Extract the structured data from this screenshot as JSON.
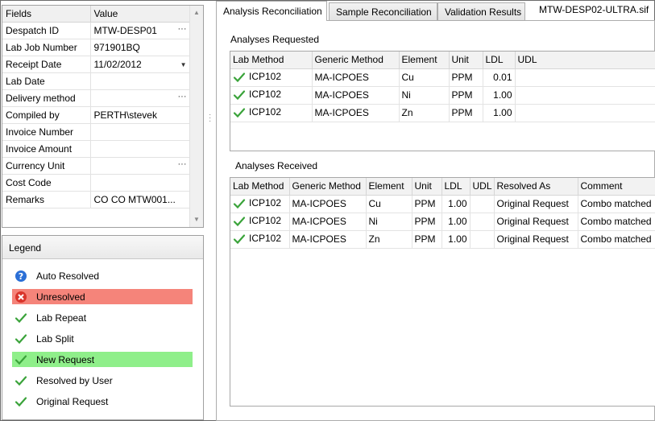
{
  "properties": {
    "headers": {
      "field": "Fields",
      "value": "Value"
    },
    "rows": [
      {
        "field": "Despatch ID",
        "value": "MTW-DESP01",
        "control": "ellipsis"
      },
      {
        "field": "Lab Job Number",
        "value": "971901BQ",
        "control": ""
      },
      {
        "field": "Receipt Date",
        "value": "11/02/2012",
        "control": "dropdown"
      },
      {
        "field": "Lab Date",
        "value": "",
        "control": ""
      },
      {
        "field": "Delivery method",
        "value": "",
        "control": "ellipsis"
      },
      {
        "field": "Compiled by",
        "value": "PERTH\\stevek",
        "control": ""
      },
      {
        "field": "Invoice Number",
        "value": "",
        "control": ""
      },
      {
        "field": "Invoice Amount",
        "value": "",
        "control": ""
      },
      {
        "field": "Currency Unit",
        "value": "",
        "control": "ellipsis"
      },
      {
        "field": "Cost Code",
        "value": "",
        "control": ""
      },
      {
        "field": "Remarks",
        "value": "CO CO MTW001...",
        "control": ""
      }
    ],
    "ellipsis_glyph": "···",
    "dropdown_glyph": "▼"
  },
  "legend": {
    "title": "Legend",
    "items": [
      {
        "label": "Auto Resolved",
        "icon": "help-circle-icon",
        "highlight": "none"
      },
      {
        "label": "Unresolved",
        "icon": "error-x-icon",
        "highlight": "#f5847a"
      },
      {
        "label": "Lab Repeat",
        "icon": "checkmark-icon",
        "highlight": "none"
      },
      {
        "label": "Lab Split",
        "icon": "checkmark-icon",
        "highlight": "none"
      },
      {
        "label": "New Request",
        "icon": "checkmark-icon",
        "highlight": "#8fef8a"
      },
      {
        "label": "Resolved by User",
        "icon": "checkmark-icon",
        "highlight": "none"
      },
      {
        "label": "Original Request",
        "icon": "checkmark-icon",
        "highlight": "none"
      }
    ]
  },
  "tabs": [
    {
      "label": "Analysis Reconciliation",
      "active": true
    },
    {
      "label": "Sample Reconciliation",
      "active": false
    },
    {
      "label": "Validation Results",
      "active": false
    }
  ],
  "file_name": "MTW-DESP02-ULTRA.sif",
  "requested": {
    "title": "Analyses Requested",
    "columns": [
      "Lab Method",
      "Generic Method",
      "Element",
      "Unit",
      "LDL",
      "UDL"
    ],
    "rows": [
      {
        "lab_method": "ICP102",
        "generic_method": "MA-ICPOES",
        "element": "Cu",
        "unit": "PPM",
        "ldl": "0.01",
        "udl": ""
      },
      {
        "lab_method": "ICP102",
        "generic_method": "MA-ICPOES",
        "element": "Ni",
        "unit": "PPM",
        "ldl": "1.00",
        "udl": ""
      },
      {
        "lab_method": "ICP102",
        "generic_method": "MA-ICPOES",
        "element": "Zn",
        "unit": "PPM",
        "ldl": "1.00",
        "udl": ""
      }
    ]
  },
  "received": {
    "title": "Analyses Received",
    "columns": [
      "Lab Method",
      "Generic Method",
      "Element",
      "Unit",
      "LDL",
      "UDL",
      "Resolved As",
      "Comment"
    ],
    "rows": [
      {
        "lab_method": "ICP102",
        "generic_method": "MA-ICPOES",
        "element": "Cu",
        "unit": "PPM",
        "ldl": "1.00",
        "udl": "",
        "resolved_as": "Original Request",
        "comment": "Combo matched"
      },
      {
        "lab_method": "ICP102",
        "generic_method": "MA-ICPOES",
        "element": "Ni",
        "unit": "PPM",
        "ldl": "1.00",
        "udl": "",
        "resolved_as": "Original Request",
        "comment": "Combo matched"
      },
      {
        "lab_method": "ICP102",
        "generic_method": "MA-ICPOES",
        "element": "Zn",
        "unit": "PPM",
        "ldl": "1.00",
        "udl": "",
        "resolved_as": "Original Request",
        "comment": "Combo matched"
      }
    ]
  },
  "colors": {
    "check_green": "#3aa33a",
    "help_blue": "#2b6fd6",
    "error_red": "#d9342b"
  }
}
